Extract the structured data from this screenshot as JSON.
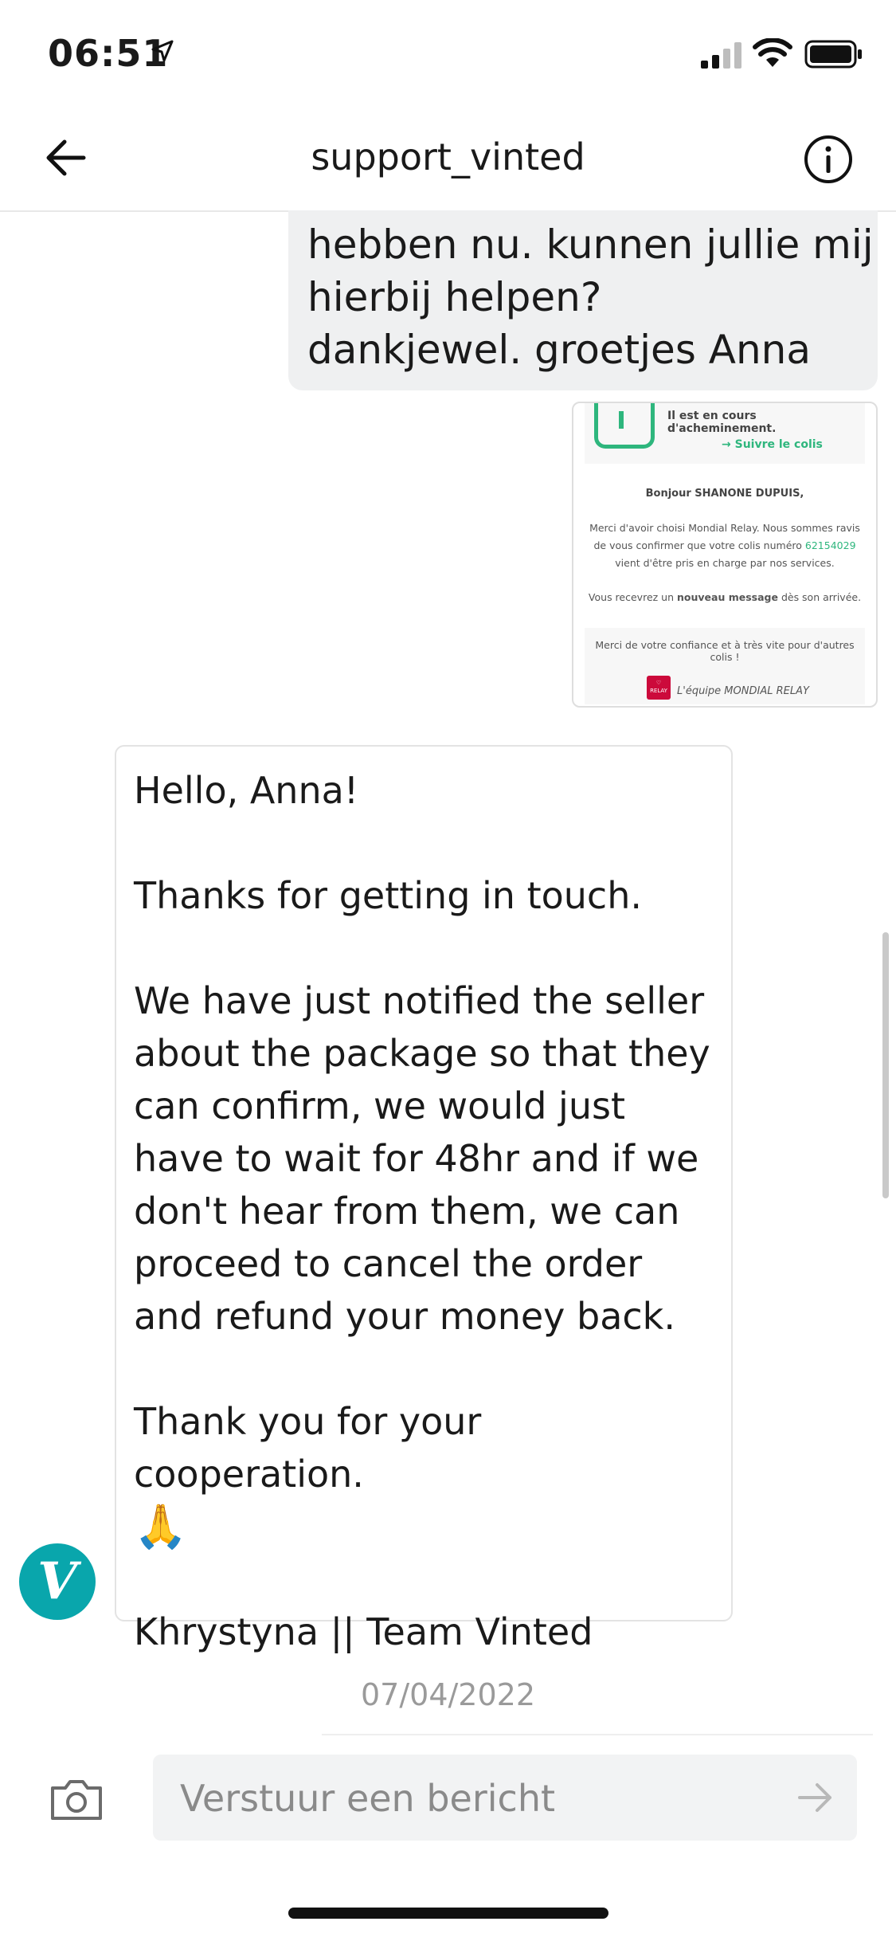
{
  "status_bar": {
    "time": "06:51",
    "icons": [
      "location-arrow-icon",
      "cellular-signal-icon",
      "wifi-icon",
      "battery-icon"
    ]
  },
  "header": {
    "title": "support_vinted",
    "back_icon": "arrow-left-icon",
    "info_icon": "info-circle-icon"
  },
  "messages": {
    "user_text": "hebben nu. kunnen jullie mij\nhierbij helpen?\ndankjewel. groetjes Anna",
    "attachment": {
      "line1": "Il est en cours d'acheminement.",
      "line2": "→ Suivre le colis",
      "greeting": "Bonjour SHANONE DUPUIS,",
      "body_a": "Merci d'avoir choisi Mondial Relay. Nous sommes ravis de vous confirmer que votre colis numéro",
      "parcel_number": "62154029",
      "body_b": "vient d'être pris en charge par nos services.",
      "notice_a": "Vous recevrez un",
      "notice_bold": "nouveau message",
      "notice_b": "dès son arrivée.",
      "thanks": "Merci de votre confiance et à très vite pour d'autres colis !",
      "logo_text": "RELAY",
      "signature": "L'équipe MONDIAL RELAY"
    },
    "support_paragraphs": [
      "Hello, Anna!",
      "Thanks for getting in touch.",
      "We have just notified the seller about the package so that they can confirm, we would just have to wait for 48hr and if we don't hear from them, we can proceed to cancel the order and refund your money back.",
      "Thank you for your cooperation."
    ],
    "emoji": "🙏",
    "signature": "Khrystyna || Team Vinted",
    "avatar_letter": "V",
    "date": "07/04/2022"
  },
  "composer": {
    "placeholder": "Verstuur een bericht",
    "camera_icon": "camera-icon",
    "send_icon": "arrow-right-icon"
  },
  "colors": {
    "brand": "#09a6ac",
    "bubble_gray": "#eff0f1",
    "mondial_green": "#2eb67d",
    "mondial_red": "#cc0a3b"
  }
}
